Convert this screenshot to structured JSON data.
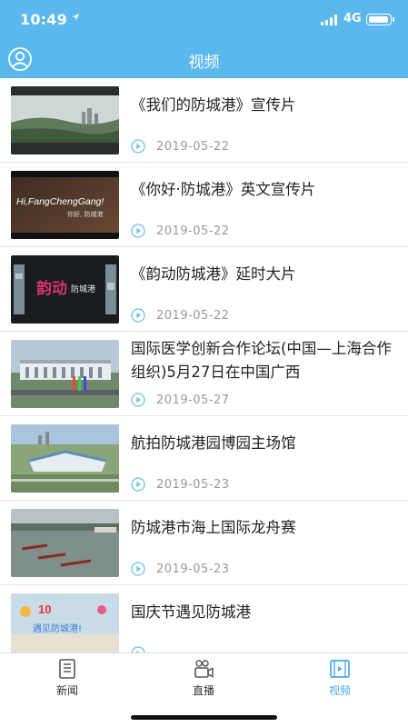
{
  "status": {
    "time": "10:49",
    "network": "4G"
  },
  "nav": {
    "title": "视频",
    "user_icon": "user-circle-icon"
  },
  "videos": [
    {
      "title": "《我们的防城港》宣传片",
      "date": "2019-05-22"
    },
    {
      "title": "《你好·防城港》英文宣传片",
      "date": "2019-05-22",
      "thumb_text": "Hi,FangChengGang!",
      "thumb_subtext": "你好, 防城港"
    },
    {
      "title": "《韵动防城港》延时大片",
      "date": "2019-05-22",
      "thumb_text": "韵动",
      "thumb_subtext": "防城港"
    },
    {
      "title": "国际医学创新合作论坛(中国—上海合作组织)5月27日在中国广西",
      "date": "2019-05-27"
    },
    {
      "title": "航拍防城港园博园主场馆",
      "date": "2019-05-23"
    },
    {
      "title": "防城港市海上国际龙舟赛",
      "date": "2019-05-23"
    },
    {
      "title": "国庆节遇见防城港",
      "date": "",
      "thumb_text": "10",
      "thumb_subtext": "遇见防城港!"
    }
  ],
  "tabs": [
    {
      "label": "新闻",
      "icon": "news-icon"
    },
    {
      "label": "直播",
      "icon": "camera-icon"
    },
    {
      "label": "视频",
      "icon": "video-icon",
      "active": true
    }
  ],
  "colors": {
    "accent": "#5bb8ec",
    "active_tab": "#4aa9e0"
  }
}
